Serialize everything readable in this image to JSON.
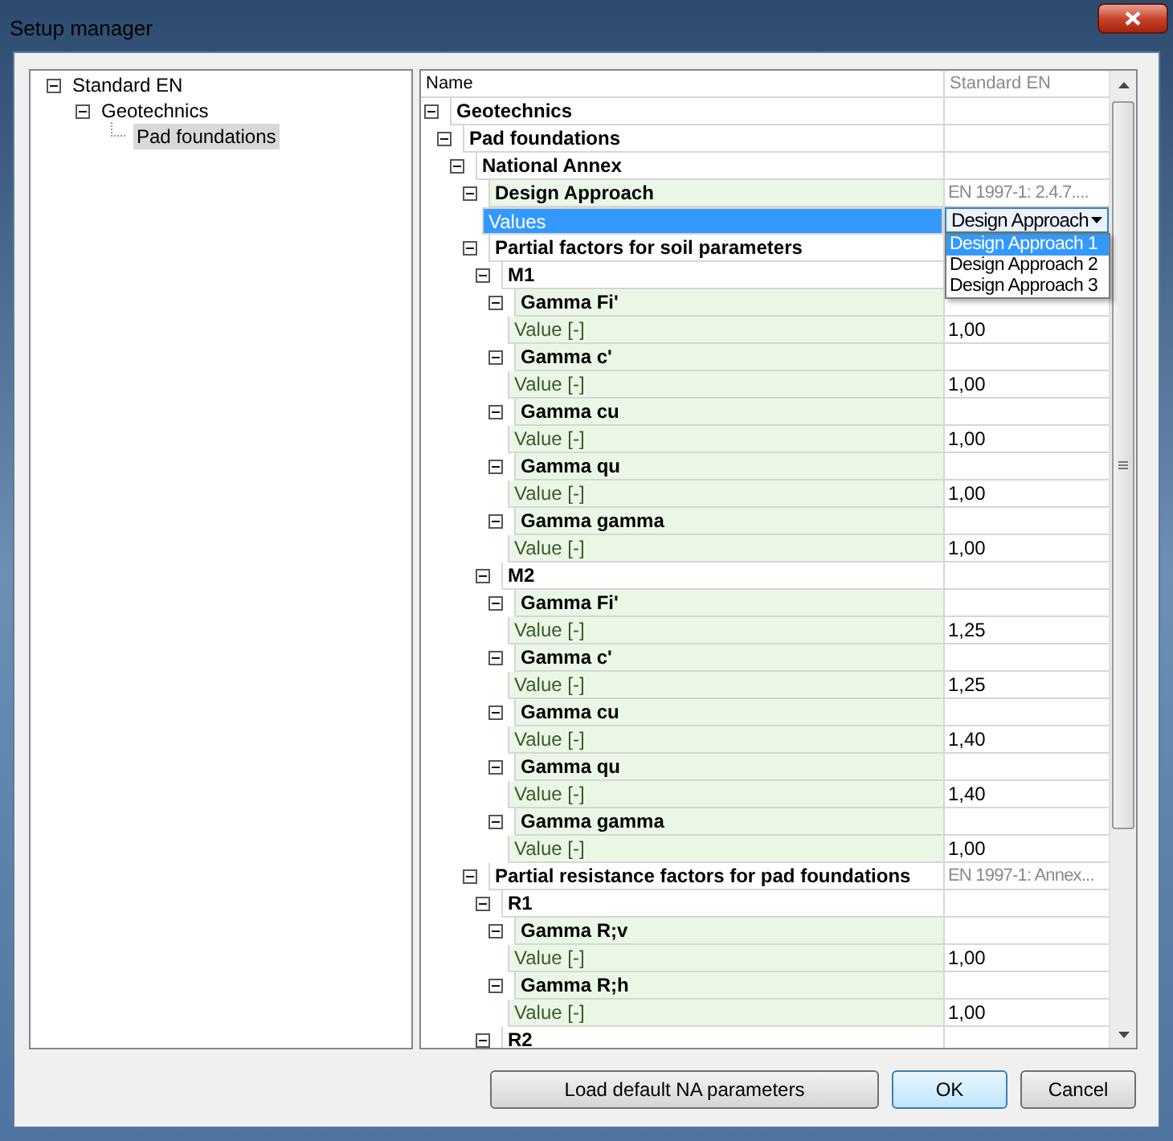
{
  "window": {
    "title": "Setup manager"
  },
  "tree": [
    {
      "label": "Standard EN",
      "expanded": true,
      "selected": false,
      "children": [
        {
          "label": "Geotechnics",
          "expanded": true,
          "selected": false,
          "children": [
            {
              "label": "Pad foundations",
              "selected": true
            }
          ]
        }
      ]
    }
  ],
  "grid": {
    "columns": [
      "Name",
      "Standard EN"
    ],
    "rows": [
      {
        "kind": "section",
        "name": "Geotechnics",
        "expanded": true,
        "children": [
          {
            "kind": "section",
            "name": "Pad foundations",
            "expanded": true,
            "children": [
              {
                "kind": "section",
                "name": "National Annex",
                "expanded": true,
                "children": [
                  {
                    "kind": "parameter",
                    "name": "Design Approach",
                    "value": "EN 1997-1: 2.4.7....",
                    "expanded": true,
                    "children": [
                      {
                        "kind": "choice",
                        "name": "Values",
                        "value": "Design Approach",
                        "selected": true,
                        "expanded": true,
                        "options": [
                          {
                            "label": "Design Approach 1",
                            "selected": true
                          },
                          {
                            "label": "Design Approach 2",
                            "selected": false
                          },
                          {
                            "label": "Design Approach 3",
                            "selected": false
                          }
                        ]
                      }
                    ]
                  },
                  {
                    "kind": "section",
                    "name": "Partial factors for soil parameters",
                    "expanded": true,
                    "children": [
                      {
                        "kind": "section",
                        "name": "M1",
                        "expanded": true,
                        "children": [
                          {
                            "kind": "parameter",
                            "name": "Gamma Fi'",
                            "expanded": true,
                            "children": [
                              {
                                "kind": "value",
                                "name": "Value [-]",
                                "value": "1,00"
                              }
                            ]
                          },
                          {
                            "kind": "parameter",
                            "name": "Gamma c'",
                            "expanded": true,
                            "children": [
                              {
                                "kind": "value",
                                "name": "Value [-]",
                                "value": "1,00"
                              }
                            ]
                          },
                          {
                            "kind": "parameter",
                            "name": "Gamma cu",
                            "expanded": true,
                            "children": [
                              {
                                "kind": "value",
                                "name": "Value [-]",
                                "value": "1,00"
                              }
                            ]
                          },
                          {
                            "kind": "parameter",
                            "name": "Gamma qu",
                            "expanded": true,
                            "children": [
                              {
                                "kind": "value",
                                "name": "Value [-]",
                                "value": "1,00"
                              }
                            ]
                          },
                          {
                            "kind": "parameter",
                            "name": "Gamma gamma",
                            "expanded": true,
                            "children": [
                              {
                                "kind": "value",
                                "name": "Value [-]",
                                "value": "1,00"
                              }
                            ]
                          }
                        ]
                      },
                      {
                        "kind": "section",
                        "name": "M2",
                        "expanded": true,
                        "children": [
                          {
                            "kind": "parameter",
                            "name": "Gamma Fi'",
                            "expanded": true,
                            "children": [
                              {
                                "kind": "value",
                                "name": "Value [-]",
                                "value": "1,25"
                              }
                            ]
                          },
                          {
                            "kind": "parameter",
                            "name": "Gamma c'",
                            "expanded": true,
                            "children": [
                              {
                                "kind": "value",
                                "name": "Value [-]",
                                "value": "1,25"
                              }
                            ]
                          },
                          {
                            "kind": "parameter",
                            "name": "Gamma cu",
                            "expanded": true,
                            "children": [
                              {
                                "kind": "value",
                                "name": "Value [-]",
                                "value": "1,40"
                              }
                            ]
                          },
                          {
                            "kind": "parameter",
                            "name": "Gamma qu",
                            "expanded": true,
                            "children": [
                              {
                                "kind": "value",
                                "name": "Value [-]",
                                "value": "1,40"
                              }
                            ]
                          },
                          {
                            "kind": "parameter",
                            "name": "Gamma gamma",
                            "expanded": true,
                            "children": [
                              {
                                "kind": "value",
                                "name": "Value [-]",
                                "value": "1,00"
                              }
                            ]
                          }
                        ]
                      }
                    ]
                  },
                  {
                    "kind": "section",
                    "name": "Partial resistance factors for pad foundations",
                    "value": "EN 1997-1: Annex...",
                    "expanded": true,
                    "children": [
                      {
                        "kind": "section",
                        "name": "R1",
                        "expanded": true,
                        "children": [
                          {
                            "kind": "parameter",
                            "name": "Gamma R;v",
                            "expanded": true,
                            "children": [
                              {
                                "kind": "value",
                                "name": "Value [-]",
                                "value": "1,00"
                              }
                            ]
                          },
                          {
                            "kind": "parameter",
                            "name": "Gamma R;h",
                            "expanded": true,
                            "children": [
                              {
                                "kind": "value",
                                "name": "Value [-]",
                                "value": "1,00"
                              }
                            ]
                          }
                        ]
                      },
                      {
                        "kind": "section",
                        "name": "R2",
                        "expanded": true
                      }
                    ]
                  }
                ]
              }
            ]
          }
        ]
      }
    ]
  },
  "buttons": [
    {
      "label": "Load default NA parameters",
      "default": false
    },
    {
      "label": "OK",
      "default": true
    },
    {
      "label": "Cancel",
      "default": false
    }
  ]
}
